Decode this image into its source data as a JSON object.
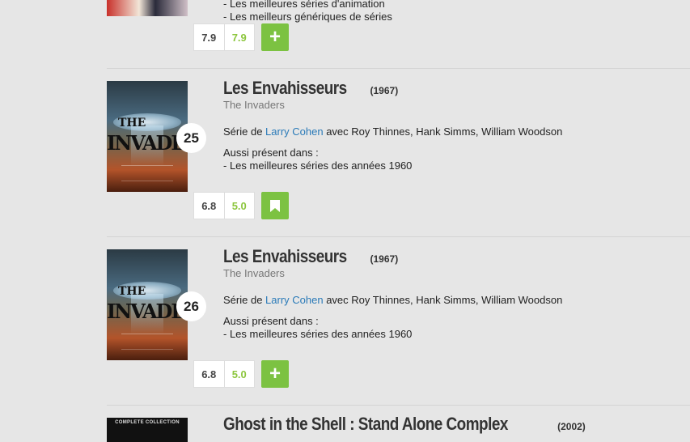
{
  "top_entry": {
    "aussi_items": [
      "- Les meilleures séries d'animation",
      "- Les meilleurs génériques de séries"
    ],
    "rating_press": "7.9",
    "rating_users": "7.9",
    "action_symbol": "+"
  },
  "entries": [
    {
      "rank": "25",
      "title": "Les Envahisseurs",
      "year": "(1967)",
      "original_title": "The Invaders",
      "desc_prefix": "Série de ",
      "director": "Larry Cohen",
      "desc_suffix": " avec Roy Thinnes, Hank Simms, William Woodson",
      "aussi_label": "Aussi présent dans :",
      "aussi_item": "- Les meilleures séries des années 1960",
      "rating_press": "6.8",
      "rating_users": "5.0",
      "action": "bookmark"
    },
    {
      "rank": "26",
      "title": "Les Envahisseurs",
      "year": "(1967)",
      "original_title": "The Invaders",
      "desc_prefix": "Série de ",
      "director": "Larry Cohen",
      "desc_suffix": " avec Roy Thinnes, Hank Simms, William Woodson",
      "aussi_label": "Aussi présent dans :",
      "aussi_item": "- Les meilleures séries des années 1960",
      "rating_press": "6.8",
      "rating_users": "5.0",
      "action_symbol": "+"
    }
  ],
  "bottom_entry": {
    "title": "Ghost in the Shell : Stand Alone Complex",
    "year": "(2002)",
    "poster_label": "COMPLETE COLLECTION"
  },
  "poster": {
    "the_text": "THE",
    "title_text": "INVADERS"
  },
  "colors": {
    "background": "#e6e6e6",
    "accent_green": "#7cc242",
    "user_rating_green": "#8cc63e",
    "link_blue": "#2a7ab8"
  },
  "icons": {
    "add": "plus-icon",
    "bookmark": "bookmark-icon"
  }
}
